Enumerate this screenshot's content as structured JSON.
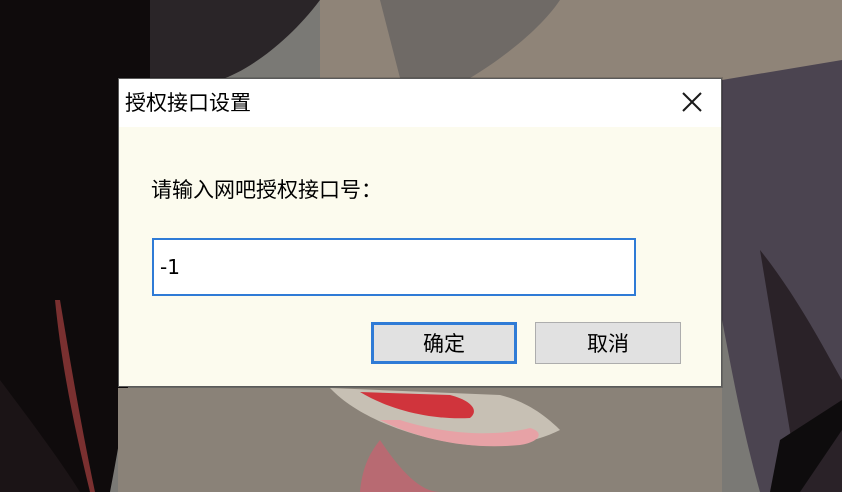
{
  "dialog": {
    "title": "授权接口设置",
    "prompt": "请输入网吧授权接口号：",
    "input_value": "-1",
    "ok_label": "确定",
    "cancel_label": "取消",
    "close_icon": "close-icon"
  },
  "colors": {
    "accent": "#2f7bd6",
    "dialog_bg": "#fcfbee",
    "button_bg": "#e1e1e1"
  }
}
